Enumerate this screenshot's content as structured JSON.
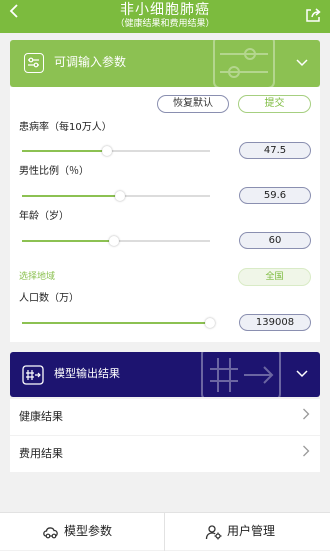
{
  "header": {
    "title": "非小细胞肺癌",
    "subtitle": "（健康结果和费用结果）",
    "back_icon": "chevron-left-icon",
    "share_icon": "share-icon",
    "color": "#7cbb3e"
  },
  "params_section": {
    "label": "可调输入参数",
    "icon": "sliders-icon",
    "color": "#8cc152"
  },
  "actions": {
    "restore_label": "恢复默认",
    "submit_label": "提交"
  },
  "params": [
    {
      "label": "患病率（每10万人）",
      "value": "47.5",
      "slider_fraction": 0.45
    },
    {
      "label": "男性比例（％）",
      "value": "59.6",
      "slider_fraction": 0.52
    },
    {
      "label": "年龄（岁）",
      "value": "60",
      "slider_fraction": 0.49
    }
  ],
  "region": {
    "label": "选择地域",
    "value": "全国"
  },
  "population": {
    "label": "人口数（万）",
    "value": "139008",
    "slider_fraction": 1.0
  },
  "output_section": {
    "label": "模型输出结果",
    "icon": "hash-arrow-icon",
    "color": "#1d1470"
  },
  "results": [
    {
      "label": "健康结果"
    },
    {
      "label": "费用结果"
    }
  ],
  "bottom_nav": {
    "model_params_label": "模型参数",
    "model_params_icon": "cloud-link-icon",
    "user_management_label": "用户管理",
    "user_management_icon": "user-gear-icon"
  }
}
